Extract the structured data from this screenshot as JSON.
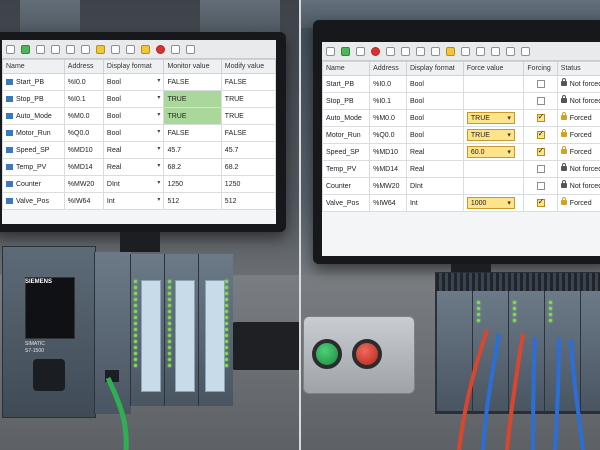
{
  "left": {
    "table": {
      "headers": [
        "Name",
        "Address",
        "Display format",
        "Monitor value",
        "Modify value"
      ],
      "rows": [
        {
          "name": "Start_PB",
          "address": "%I0.0",
          "format": "Bool",
          "monitor": "FALSE",
          "modify": "FALSE",
          "monitor_true": false
        },
        {
          "name": "Stop_PB",
          "address": "%I0.1",
          "format": "Bool",
          "monitor": "TRUE",
          "modify": "TRUE",
          "monitor_true": true
        },
        {
          "name": "Auto_Mode",
          "address": "%M0.0",
          "format": "Bool",
          "monitor": "TRUE",
          "modify": "TRUE",
          "monitor_true": true
        },
        {
          "name": "Motor_Run",
          "address": "%Q0.0",
          "format": "Bool",
          "monitor": "FALSE",
          "modify": "FALSE",
          "monitor_true": false
        },
        {
          "name": "Speed_SP",
          "address": "%MD10",
          "format": "Real",
          "monitor": "45.7",
          "modify": "45.7",
          "monitor_true": false
        },
        {
          "name": "Temp_PV",
          "address": "%MD14",
          "format": "Real",
          "monitor": "68.2",
          "modify": "68.2",
          "monitor_true": false
        },
        {
          "name": "Counter",
          "address": "%MW20",
          "format": "DInt",
          "monitor": "1250",
          "modify": "1250",
          "monitor_true": false
        },
        {
          "name": "Valve_Pos",
          "address": "%IW64",
          "format": "Int",
          "monitor": "512",
          "modify": "512",
          "monitor_true": false
        }
      ]
    },
    "plc": {
      "brand": "SIEMENS",
      "model_line1": "SIMATIC",
      "model_line2": "S7-1500"
    }
  },
  "right": {
    "table": {
      "headers": [
        "Name",
        "Address",
        "Display format",
        "Force value",
        "Forcing",
        "Status"
      ],
      "rows": [
        {
          "name": "Start_PB",
          "address": "%I0.0",
          "format": "Bool",
          "force": "",
          "forcing": false,
          "status": "Not forced"
        },
        {
          "name": "Stop_PB",
          "address": "%I0.1",
          "format": "Bool",
          "force": "",
          "forcing": false,
          "status": "Not forced"
        },
        {
          "name": "Auto_Mode",
          "address": "%M0.0",
          "format": "Bool",
          "force": "TRUE",
          "forcing": true,
          "status": "Forced"
        },
        {
          "name": "Motor_Run",
          "address": "%Q0.0",
          "format": "Bool",
          "force": "TRUE",
          "forcing": true,
          "status": "Forced"
        },
        {
          "name": "Speed_SP",
          "address": "%MD10",
          "format": "Real",
          "force": "60.0",
          "forcing": true,
          "status": "Forced"
        },
        {
          "name": "Temp_PV",
          "address": "%MD14",
          "format": "Real",
          "force": "",
          "forcing": false,
          "status": "Not forced"
        },
        {
          "name": "Counter",
          "address": "%MW20",
          "format": "DInt",
          "force": "",
          "forcing": false,
          "status": "Not forced"
        },
        {
          "name": "Valve_Pos",
          "address": "%IW64",
          "format": "Int",
          "force": "1000",
          "forcing": true,
          "status": "Forced"
        }
      ]
    }
  },
  "colors": {
    "true_fill": "#a9d89a",
    "force_fill": "#fde48a",
    "led_green": "#7ee04d",
    "cable_green": "#2fae54",
    "cable_red": "#d8462e",
    "cable_blue": "#2b6fd6"
  }
}
